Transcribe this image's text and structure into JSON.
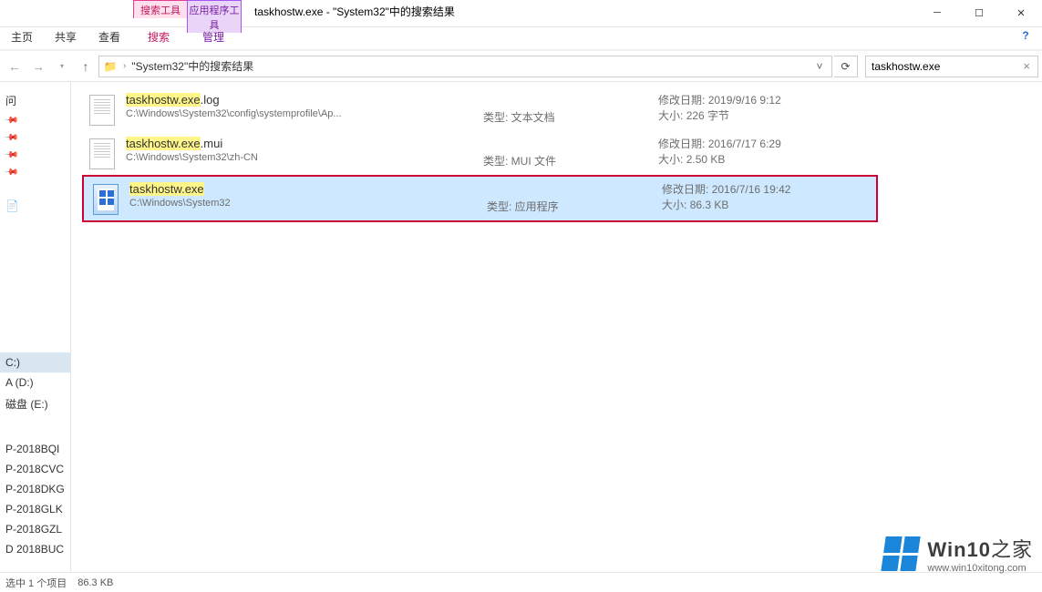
{
  "window": {
    "title": "taskhostw.exe - \"System32\"中的搜索结果",
    "tools_search": "搜索工具",
    "tools_app": "应用程序工具",
    "sub_search": "搜索",
    "sub_manage": "管理"
  },
  "ribbon": {
    "home": "主页",
    "share": "共享",
    "view": "查看"
  },
  "nav": {
    "location": "\"System32\"中的搜索结果",
    "search_value": "taskhostw.exe"
  },
  "sidebar": {
    "quick": "问",
    "pc_label": "C:)",
    "drives": [
      "A (D:)",
      "磁盘 (E:)"
    ],
    "network": [
      "P-2018BQI",
      "P-2018CVC",
      "P-2018DKG",
      "P-2018GLK",
      "P-2018GZL",
      "D 2018BUC"
    ]
  },
  "labels": {
    "modified": "修改日期:",
    "type": "类型:",
    "size": "大小:"
  },
  "results": [
    {
      "name_hl": "taskhostw.exe",
      "name_rest": ".log",
      "path": "C:\\Windows\\System32\\config\\systemprofile\\Ap...",
      "type": "文本文档",
      "modified": "2019/9/16 9:12",
      "size": "226 字节",
      "icon": "txt",
      "selected": false,
      "boxed": false
    },
    {
      "name_hl": "taskhostw.exe",
      "name_rest": ".mui",
      "path": "C:\\Windows\\System32\\zh-CN",
      "type": "MUI 文件",
      "modified": "2016/7/17 6:29",
      "size": "2.50 KB",
      "icon": "txt",
      "selected": false,
      "boxed": false
    },
    {
      "name_hl": "taskhostw.exe",
      "name_rest": "",
      "path": "C:\\Windows\\System32",
      "type": "应用程序",
      "modified": "2016/7/16 19:42",
      "size": "86.3 KB",
      "icon": "exe",
      "selected": true,
      "boxed": true
    }
  ],
  "status": {
    "selected": "选中 1 个项目",
    "size": "86.3 KB"
  },
  "watermark": {
    "title_en": "Win10",
    "title_zh": "之家",
    "url": "www.win10xitong.com"
  }
}
